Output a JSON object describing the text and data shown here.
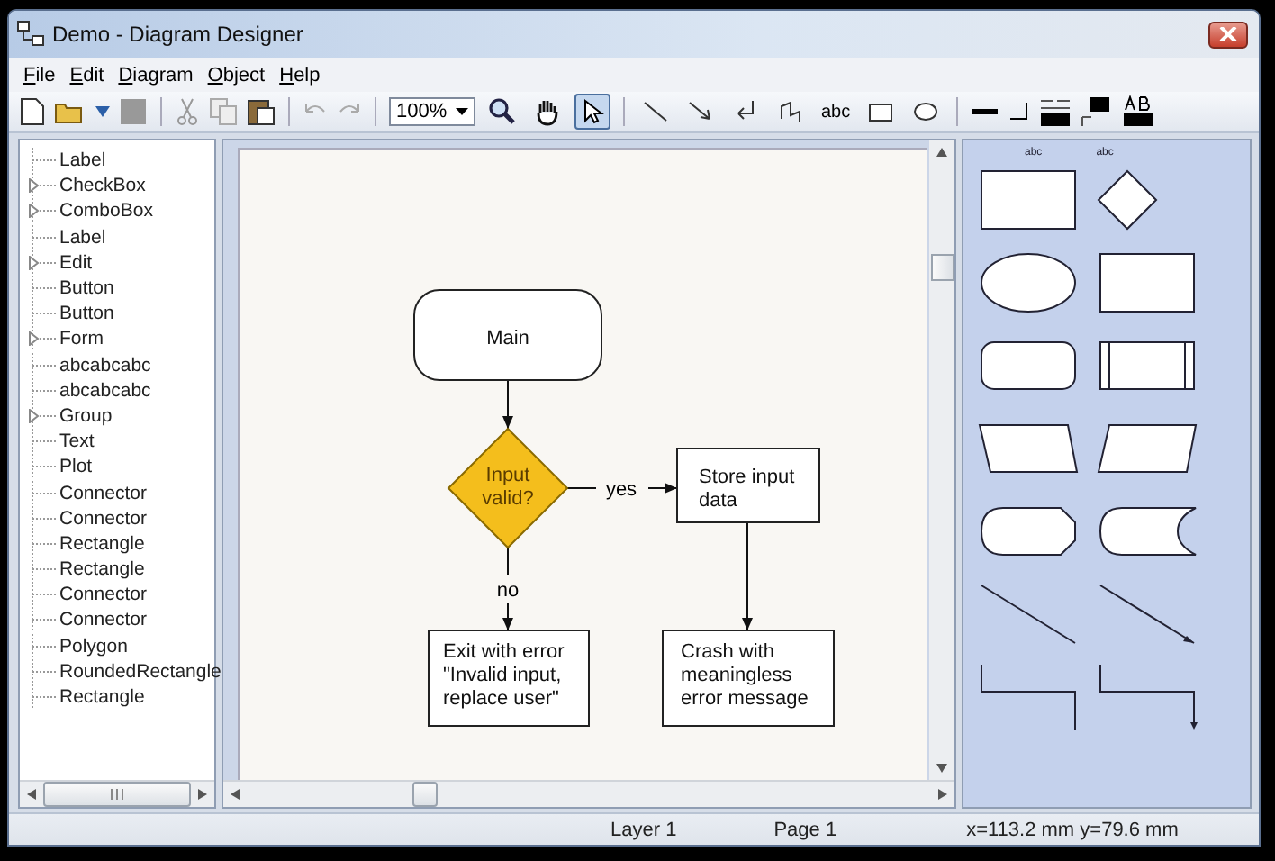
{
  "window": {
    "title": "Demo - Diagram Designer"
  },
  "menu": [
    "File",
    "Edit",
    "Diagram",
    "Object",
    "Help"
  ],
  "toolbar": {
    "zoom": "100%",
    "tools": [
      {
        "kind": "zoom",
        "selected": false
      },
      {
        "kind": "pan",
        "selected": false
      },
      {
        "kind": "pointer",
        "selected": true
      },
      {
        "kind": "line",
        "selected": false
      },
      {
        "kind": "arrow",
        "selected": false
      },
      {
        "kind": "connector",
        "selected": false
      },
      {
        "kind": "polyline",
        "selected": false
      },
      {
        "kind": "text",
        "label": "abc",
        "selected": false
      },
      {
        "kind": "rectangle",
        "selected": false
      },
      {
        "kind": "ellipse",
        "selected": false
      }
    ]
  },
  "tree": [
    {
      "label": "Label",
      "expandable": false
    },
    {
      "label": "CheckBox",
      "expandable": true
    },
    {
      "label": "ComboBox",
      "expandable": true
    },
    {
      "label": "Label",
      "expandable": false
    },
    {
      "label": "Edit",
      "expandable": true
    },
    {
      "label": "Button",
      "expandable": false
    },
    {
      "label": "Button",
      "expandable": false
    },
    {
      "label": "Form",
      "expandable": true
    },
    {
      "label": "abcabcabc",
      "expandable": false
    },
    {
      "label": "abcabcabc",
      "expandable": false
    },
    {
      "label": "Group",
      "expandable": true
    },
    {
      "label": "Text",
      "expandable": false
    },
    {
      "label": "Plot",
      "expandable": false
    },
    {
      "label": "Connector",
      "expandable": false
    },
    {
      "label": "Connector",
      "expandable": false
    },
    {
      "label": "Rectangle",
      "expandable": false
    },
    {
      "label": "Rectangle",
      "expandable": false
    },
    {
      "label": "Connector",
      "expandable": false
    },
    {
      "label": "Connector",
      "expandable": false
    },
    {
      "label": "Polygon",
      "expandable": false
    },
    {
      "label": "RoundedRectangle",
      "expandable": false
    },
    {
      "label": "Rectangle",
      "expandable": false
    }
  ],
  "diagram": {
    "nodes": [
      {
        "kind": "terminal",
        "lines": [
          "Main"
        ]
      },
      {
        "kind": "decision",
        "lines": [
          "Input",
          "valid?"
        ]
      },
      {
        "kind": "process",
        "lines": [
          "Store input",
          "data"
        ]
      },
      {
        "kind": "process",
        "lines": [
          "Exit with error",
          "\"Invalid input,",
          "replace user\""
        ]
      },
      {
        "kind": "process",
        "lines": [
          "Crash with",
          "meaningless",
          "error message"
        ]
      }
    ],
    "connectors": [
      {
        "label": "yes"
      },
      {
        "label": "no"
      }
    ]
  },
  "palette": {
    "labels": [
      "abc",
      "abc"
    ]
  },
  "status_bar": [
    "Layer 1",
    "Page 1",
    "x=113.2 mm  y=79.6 mm"
  ]
}
